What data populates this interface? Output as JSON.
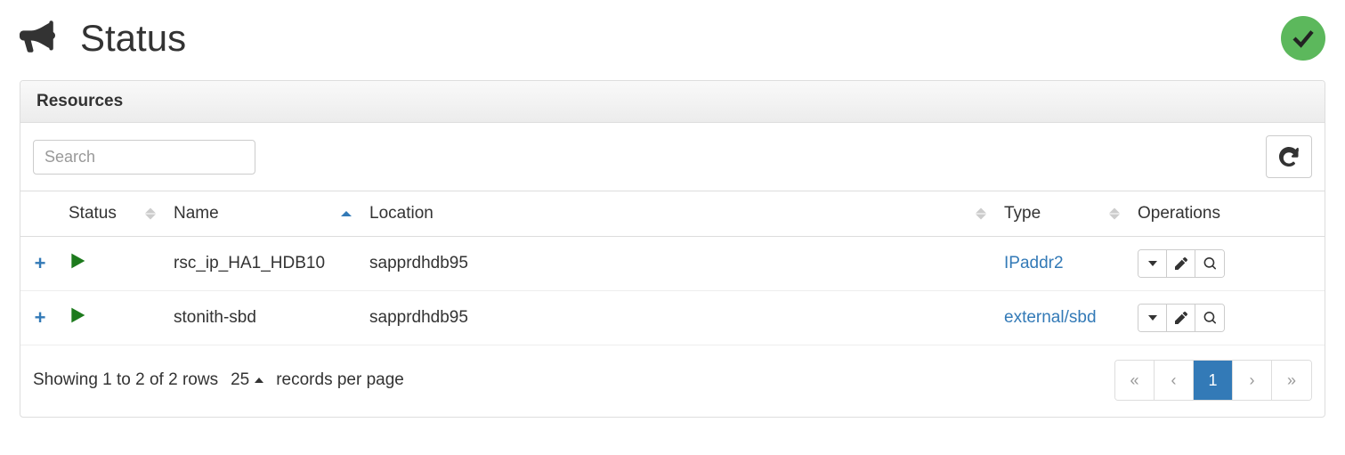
{
  "header": {
    "title": "Status"
  },
  "panel": {
    "title": "Resources"
  },
  "toolbar": {
    "search_placeholder": "Search"
  },
  "table": {
    "columns": {
      "status": "Status",
      "name": "Name",
      "location": "Location",
      "type": "Type",
      "operations": "Operations"
    },
    "rows": [
      {
        "name": "rsc_ip_HA1_HDB10",
        "location": "sapprdhdb95",
        "type": "IPaddr2"
      },
      {
        "name": "stonith-sbd",
        "location": "sapprdhdb95",
        "type": "external/sbd"
      }
    ]
  },
  "footer": {
    "showing_text": "Showing 1 to 2 of 2 rows",
    "page_size": "25",
    "records_label": "records per page",
    "pagination": {
      "first": "«",
      "prev": "‹",
      "current": "1",
      "next": "›",
      "last": "»"
    }
  }
}
